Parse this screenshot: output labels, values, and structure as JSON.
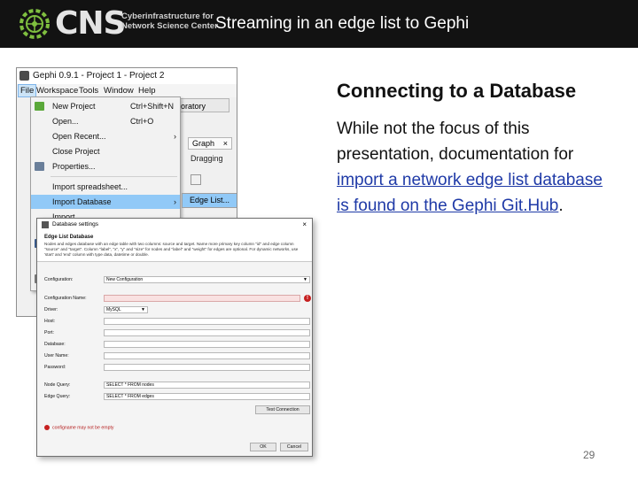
{
  "header": {
    "logo_text": "CNS",
    "logo_subtitle_line1": "Cyberinfrastructure for",
    "logo_subtitle_line2": "Network Science Center",
    "title": "Streaming in an edge list to Gephi",
    "background": "#121212"
  },
  "gephi_window": {
    "title": "Gephi 0.9.1 - Project 1 - Project 2",
    "menubar": [
      "File",
      "Workspace",
      "Tools",
      "Window",
      "Help"
    ],
    "laboratory_tab": "aboratory",
    "graph_tab": "Graph",
    "graph_tab_close": "×",
    "dragging_label": "Dragging",
    "file_menu": [
      {
        "label": "New Project",
        "shortcut": "Ctrl+Shift+N",
        "icon": "new-project-icon"
      },
      {
        "label": "Open...",
        "shortcut": "Ctrl+O"
      },
      {
        "label": "Open Recent...",
        "submenu": "›"
      },
      {
        "label": "Close Project"
      },
      {
        "label": "Properties...",
        "icon": "properties-icon"
      },
      {
        "label": "Import spreadsheet..."
      },
      {
        "label": "Import Database",
        "submenu": "›"
      },
      {
        "label": "Import"
      }
    ],
    "submenu_item": "Edge List..."
  },
  "database_dialog": {
    "title": "Database settings",
    "close": "×",
    "section_title": "Edge List Database",
    "description": "Nodes and edges database with an edge table with two columns: source and target. Name more primary key column \"id\" and edge column \"source\" and \"target\". Column \"label\", \"x\", \"y\" and \"size\" for nodes and \"label\" and \"weight\" for edges are optional. For dynamic networks, use 'start' and 'end' column with type data, datetime or double.",
    "fields": [
      {
        "label": "Configuration:",
        "value": "New Configuration"
      },
      {
        "label": "Configuration Name:",
        "value": ""
      },
      {
        "label": "Driver:",
        "value": "MySQL"
      },
      {
        "label": "Host:",
        "value": ""
      },
      {
        "label": "Port:",
        "value": ""
      },
      {
        "label": "Database:",
        "value": ""
      },
      {
        "label": "User Name:",
        "value": ""
      },
      {
        "label": "Password:",
        "value": ""
      },
      {
        "label": "Node Query:",
        "value": "SELECT * FROM nodes"
      },
      {
        "label": "Edge Query:",
        "value": "SELECT * FROM edges"
      }
    ],
    "test_button": "Test Connection",
    "error_message": "configname may not be empty",
    "ok_button": "OK",
    "cancel_button": "Cancel"
  },
  "content": {
    "heading": "Connecting to a Database",
    "body_before_link": "While not the focus of this presentation, documentation for ",
    "link1": "import a network edge list database is found on the Gephi Git.Hub",
    "body_after_link": ".",
    "link_color": "#1f3aa7"
  },
  "page_number": "29"
}
